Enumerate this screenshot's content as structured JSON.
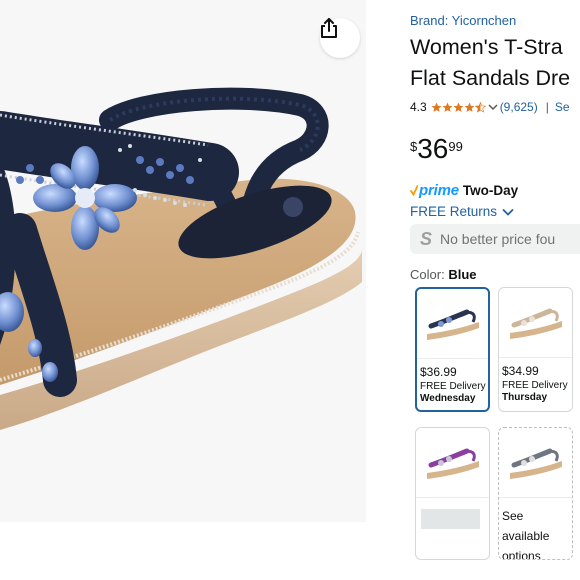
{
  "share": {
    "icon": "share-icon"
  },
  "product": {
    "brand": "Brand: Yicornchen",
    "title_line1": "Women's T-Stra",
    "title_line2": "Flat Sandals Dre",
    "rating": "4.3",
    "rating_stars": 4.3,
    "rating_count": "(9,625)",
    "rating_sep": "|",
    "see_link": "Se"
  },
  "price": {
    "symbol": "$",
    "whole": "36",
    "fraction": "99"
  },
  "delivery": {
    "prime_label": "prime",
    "prime_speed": "Two-Day",
    "returns_label": "FREE Returns"
  },
  "better_price": {
    "icon_letter": "S",
    "text": "No better price fou"
  },
  "color": {
    "label": "Color:",
    "value": "Blue"
  },
  "swatches": [
    {
      "price": "$36.99",
      "delivery": "FREE Delivery",
      "day": "Wednesday",
      "selected": true
    },
    {
      "price": "$34.99",
      "delivery": "FREE Delivery",
      "day": "Thursday",
      "selected": false
    },
    {
      "price": "",
      "delivery": "",
      "day": "",
      "selected": false
    },
    {
      "see_line1": "See",
      "see_line2": "available",
      "see_line3": "options"
    }
  ],
  "colors": {
    "link": "#2162a1",
    "prime": "#1399ff",
    "star": "#de7921",
    "selected_border": "#2162a1"
  }
}
